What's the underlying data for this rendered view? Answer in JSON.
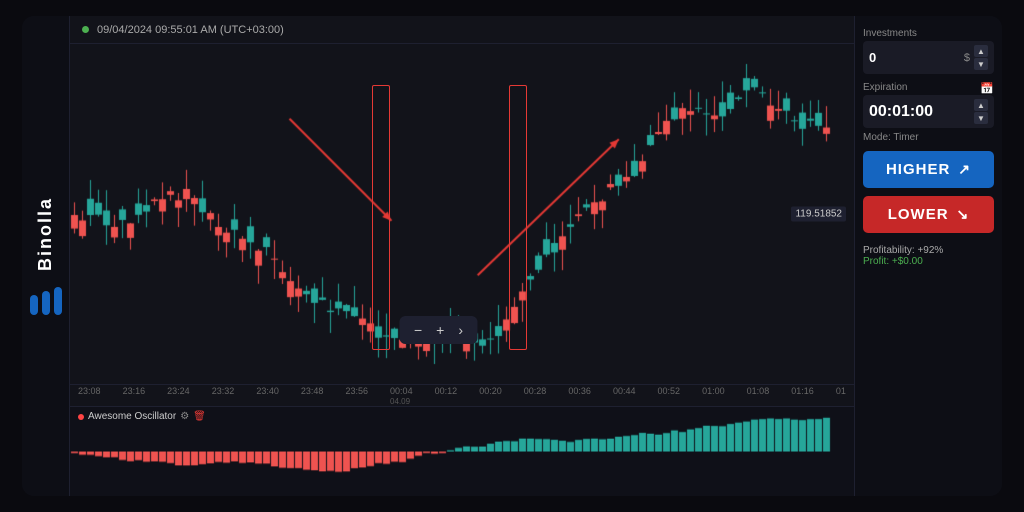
{
  "app": {
    "name": "Binolla",
    "logo_icon": "m"
  },
  "header": {
    "dot_color": "#4caf50",
    "datetime": "09/04/2024 09:55:01 AM (UTC+03:00)"
  },
  "chart": {
    "price_label": "119.51852",
    "candles": []
  },
  "time_axis": {
    "ticks": [
      "23:08",
      "23:16",
      "23:24",
      "23:32",
      "23:40",
      "23:48",
      "23:56",
      "00:04",
      "00:12",
      "00:20",
      "00:28",
      "00:36",
      "00:44",
      "00:52",
      "01:00",
      "01:08",
      "01:16",
      "01"
    ]
  },
  "toolbar": {
    "minus": "−",
    "plus": "+",
    "arrow": "›"
  },
  "oscillator": {
    "label": "Awesome Oscillator"
  },
  "right_panel": {
    "investments_label": "Investments",
    "investments_value": "0",
    "investments_currency": "$",
    "expiration_label": "Expiration",
    "timer_value": "00:01:00",
    "mode_label": "Mode: Timer",
    "btn_higher_label": "HIGHER",
    "btn_lower_label": "LOWER",
    "profitability_label": "Profitability: +92%",
    "profit_label": "Profit: +$0.00",
    "arrow_up": "▲",
    "arrow_down": "▼"
  }
}
